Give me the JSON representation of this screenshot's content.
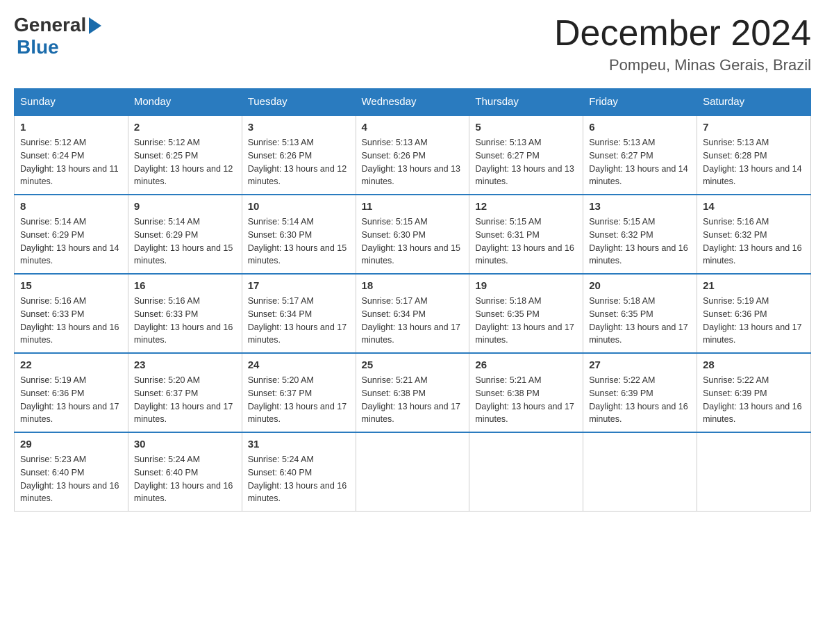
{
  "logo": {
    "general": "General",
    "blue": "Blue"
  },
  "title": "December 2024",
  "location": "Pompeu, Minas Gerais, Brazil",
  "days_of_week": [
    "Sunday",
    "Monday",
    "Tuesday",
    "Wednesday",
    "Thursday",
    "Friday",
    "Saturday"
  ],
  "weeks": [
    [
      {
        "day": "1",
        "sunrise": "5:12 AM",
        "sunset": "6:24 PM",
        "daylight": "13 hours and 11 minutes."
      },
      {
        "day": "2",
        "sunrise": "5:12 AM",
        "sunset": "6:25 PM",
        "daylight": "13 hours and 12 minutes."
      },
      {
        "day": "3",
        "sunrise": "5:13 AM",
        "sunset": "6:26 PM",
        "daylight": "13 hours and 12 minutes."
      },
      {
        "day": "4",
        "sunrise": "5:13 AM",
        "sunset": "6:26 PM",
        "daylight": "13 hours and 13 minutes."
      },
      {
        "day": "5",
        "sunrise": "5:13 AM",
        "sunset": "6:27 PM",
        "daylight": "13 hours and 13 minutes."
      },
      {
        "day": "6",
        "sunrise": "5:13 AM",
        "sunset": "6:27 PM",
        "daylight": "13 hours and 14 minutes."
      },
      {
        "day": "7",
        "sunrise": "5:13 AM",
        "sunset": "6:28 PM",
        "daylight": "13 hours and 14 minutes."
      }
    ],
    [
      {
        "day": "8",
        "sunrise": "5:14 AM",
        "sunset": "6:29 PM",
        "daylight": "13 hours and 14 minutes."
      },
      {
        "day": "9",
        "sunrise": "5:14 AM",
        "sunset": "6:29 PM",
        "daylight": "13 hours and 15 minutes."
      },
      {
        "day": "10",
        "sunrise": "5:14 AM",
        "sunset": "6:30 PM",
        "daylight": "13 hours and 15 minutes."
      },
      {
        "day": "11",
        "sunrise": "5:15 AM",
        "sunset": "6:30 PM",
        "daylight": "13 hours and 15 minutes."
      },
      {
        "day": "12",
        "sunrise": "5:15 AM",
        "sunset": "6:31 PM",
        "daylight": "13 hours and 16 minutes."
      },
      {
        "day": "13",
        "sunrise": "5:15 AM",
        "sunset": "6:32 PM",
        "daylight": "13 hours and 16 minutes."
      },
      {
        "day": "14",
        "sunrise": "5:16 AM",
        "sunset": "6:32 PM",
        "daylight": "13 hours and 16 minutes."
      }
    ],
    [
      {
        "day": "15",
        "sunrise": "5:16 AM",
        "sunset": "6:33 PM",
        "daylight": "13 hours and 16 minutes."
      },
      {
        "day": "16",
        "sunrise": "5:16 AM",
        "sunset": "6:33 PM",
        "daylight": "13 hours and 16 minutes."
      },
      {
        "day": "17",
        "sunrise": "5:17 AM",
        "sunset": "6:34 PM",
        "daylight": "13 hours and 17 minutes."
      },
      {
        "day": "18",
        "sunrise": "5:17 AM",
        "sunset": "6:34 PM",
        "daylight": "13 hours and 17 minutes."
      },
      {
        "day": "19",
        "sunrise": "5:18 AM",
        "sunset": "6:35 PM",
        "daylight": "13 hours and 17 minutes."
      },
      {
        "day": "20",
        "sunrise": "5:18 AM",
        "sunset": "6:35 PM",
        "daylight": "13 hours and 17 minutes."
      },
      {
        "day": "21",
        "sunrise": "5:19 AM",
        "sunset": "6:36 PM",
        "daylight": "13 hours and 17 minutes."
      }
    ],
    [
      {
        "day": "22",
        "sunrise": "5:19 AM",
        "sunset": "6:36 PM",
        "daylight": "13 hours and 17 minutes."
      },
      {
        "day": "23",
        "sunrise": "5:20 AM",
        "sunset": "6:37 PM",
        "daylight": "13 hours and 17 minutes."
      },
      {
        "day": "24",
        "sunrise": "5:20 AM",
        "sunset": "6:37 PM",
        "daylight": "13 hours and 17 minutes."
      },
      {
        "day": "25",
        "sunrise": "5:21 AM",
        "sunset": "6:38 PM",
        "daylight": "13 hours and 17 minutes."
      },
      {
        "day": "26",
        "sunrise": "5:21 AM",
        "sunset": "6:38 PM",
        "daylight": "13 hours and 17 minutes."
      },
      {
        "day": "27",
        "sunrise": "5:22 AM",
        "sunset": "6:39 PM",
        "daylight": "13 hours and 16 minutes."
      },
      {
        "day": "28",
        "sunrise": "5:22 AM",
        "sunset": "6:39 PM",
        "daylight": "13 hours and 16 minutes."
      }
    ],
    [
      {
        "day": "29",
        "sunrise": "5:23 AM",
        "sunset": "6:40 PM",
        "daylight": "13 hours and 16 minutes."
      },
      {
        "day": "30",
        "sunrise": "5:24 AM",
        "sunset": "6:40 PM",
        "daylight": "13 hours and 16 minutes."
      },
      {
        "day": "31",
        "sunrise": "5:24 AM",
        "sunset": "6:40 PM",
        "daylight": "13 hours and 16 minutes."
      },
      null,
      null,
      null,
      null
    ]
  ]
}
